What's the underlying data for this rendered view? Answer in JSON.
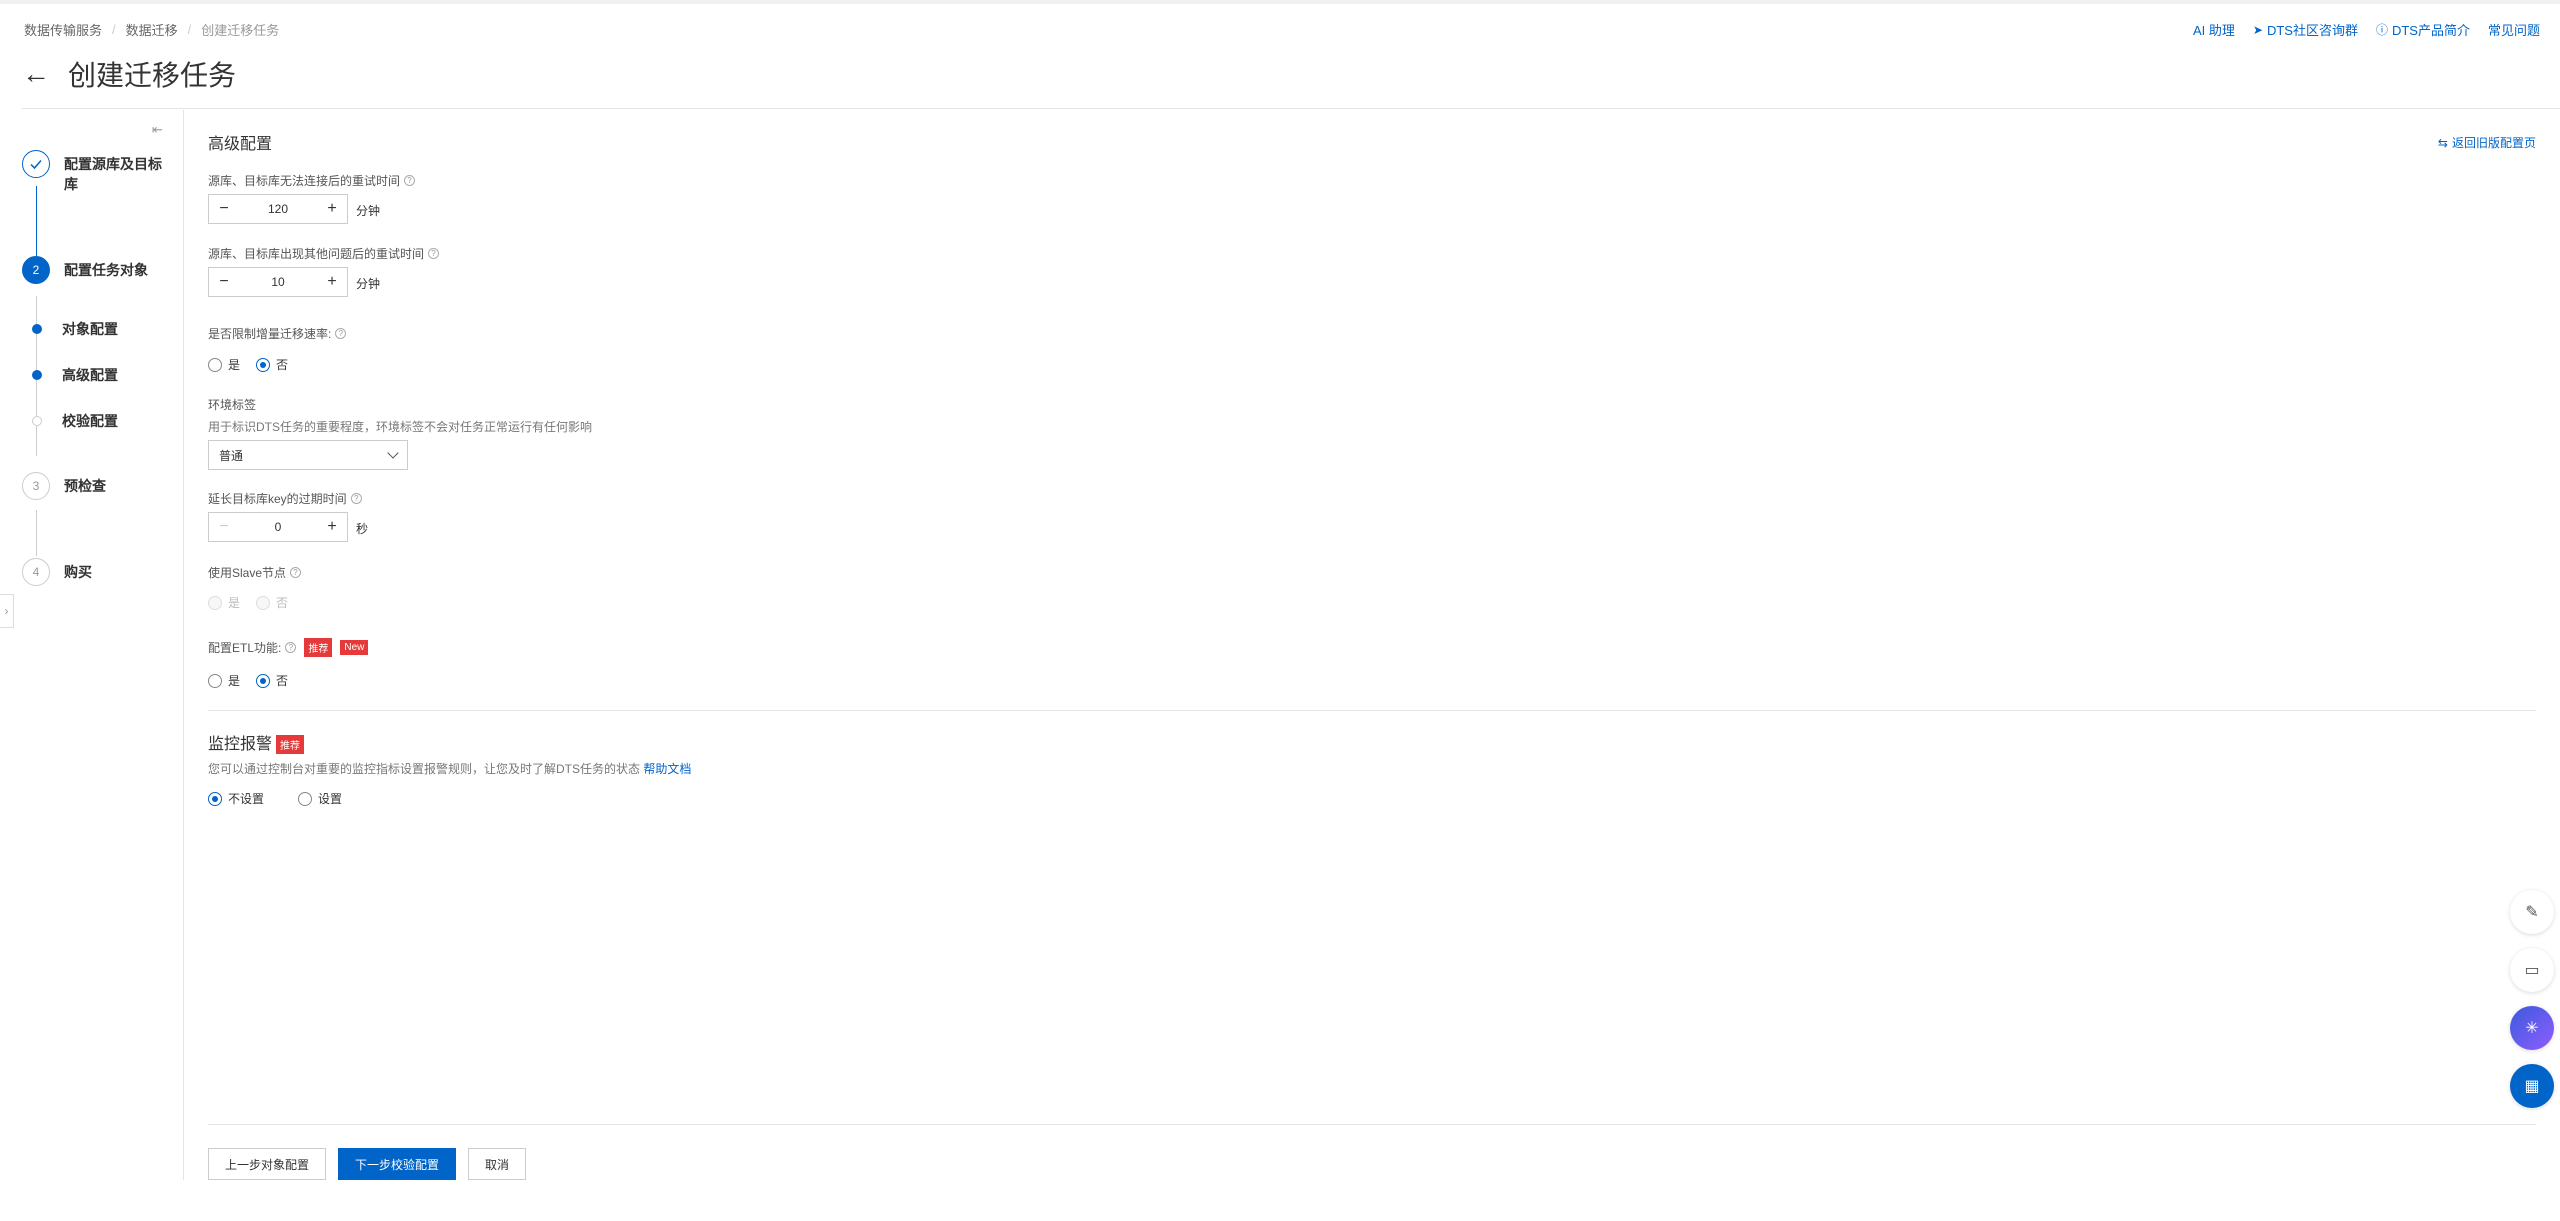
{
  "breadcrumb": [
    "数据传输服务",
    "数据迁移",
    "创建迁移任务"
  ],
  "top_links": {
    "ai": "AI 助理",
    "community": "DTS社区咨询群",
    "intro": "DTS产品简介",
    "faq": "常见问题"
  },
  "page_title": "创建迁移任务",
  "steps": {
    "s1": "配置源库及目标库",
    "s2_num": "2",
    "s2": "配置任务对象",
    "sub1": "对象配置",
    "sub2": "高级配置",
    "sub3": "校验配置",
    "s3_num": "3",
    "s3": "预检查",
    "s4_num": "4",
    "s4": "购买"
  },
  "advanced": {
    "title": "高级配置",
    "return_link": "返回旧版配置页",
    "retry_conn_label": "源库、目标库无法连接后的重试时间",
    "retry_conn_value": "120",
    "retry_other_label": "源库、目标库出现其他问题后的重试时间",
    "retry_other_value": "10",
    "unit_min": "分钟",
    "limit_label": "是否限制增量迁移速率:",
    "yes": "是",
    "no": "否",
    "env_label": "环境标签",
    "env_hint": "用于标识DTS任务的重要程度，环境标签不会对任务正常运行有任何影响",
    "env_value": "普通",
    "ttl_label": "延长目标库key的过期时间",
    "ttl_value": "0",
    "unit_sec": "秒",
    "slave_label": "使用Slave节点",
    "etl_label": "配置ETL功能:",
    "tag_recommend": "推荐",
    "tag_new": "New"
  },
  "monitor": {
    "title": "监控报警",
    "tag": "推荐",
    "hint": "您可以通过控制台对重要的监控指标设置报警规则，让您及时了解DTS任务的状态",
    "help": "帮助文档",
    "opt_none": "不设置",
    "opt_set": "设置"
  },
  "footer": {
    "prev": "上一步对象配置",
    "next": "下一步校验配置",
    "cancel": "取消"
  },
  "colors": {
    "accent": "#0064c8",
    "tag": "#e63a3a"
  }
}
